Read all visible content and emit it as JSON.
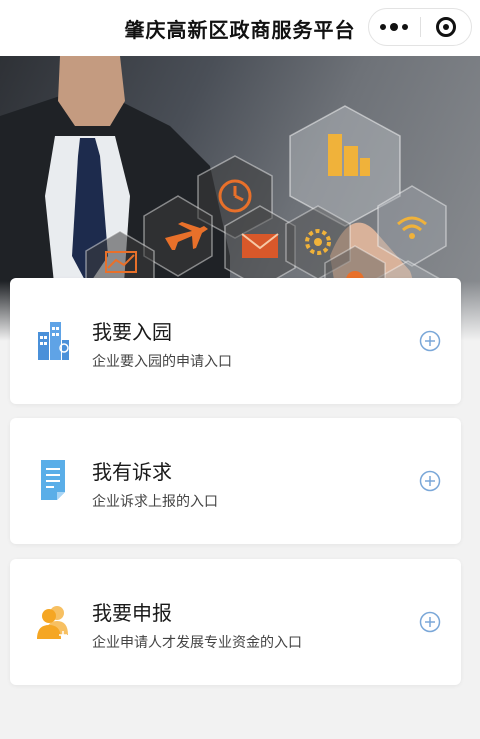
{
  "nav": {
    "title": "肇庆高新区政商服务平台",
    "more_icon": "more-dots-icon",
    "close_icon": "target-close-icon"
  },
  "banner": {
    "icons": [
      "building-icon",
      "alarm-clock-icon",
      "airplane-icon",
      "chart-icon",
      "mail-icon",
      "gear-icon",
      "wifi-cloud-icon",
      "person-icon"
    ]
  },
  "cards": [
    {
      "title": "我要入园",
      "subtitle": "企业要入园的申请入口",
      "icon": "building-icon",
      "icon_color": "#4a90d9"
    },
    {
      "title": "我有诉求",
      "subtitle": "企业诉求上报的入口",
      "icon": "document-icon",
      "icon_color": "#5aaee8"
    },
    {
      "title": "我要申报",
      "subtitle": "企业申请人才发展专业资金的入口",
      "icon": "users-icon",
      "icon_color": "#f5a623"
    }
  ],
  "colors": {
    "accent_plus": "#7aa7d8",
    "hex_orange": "#e8702a",
    "hex_gold": "#f0b23a"
  }
}
